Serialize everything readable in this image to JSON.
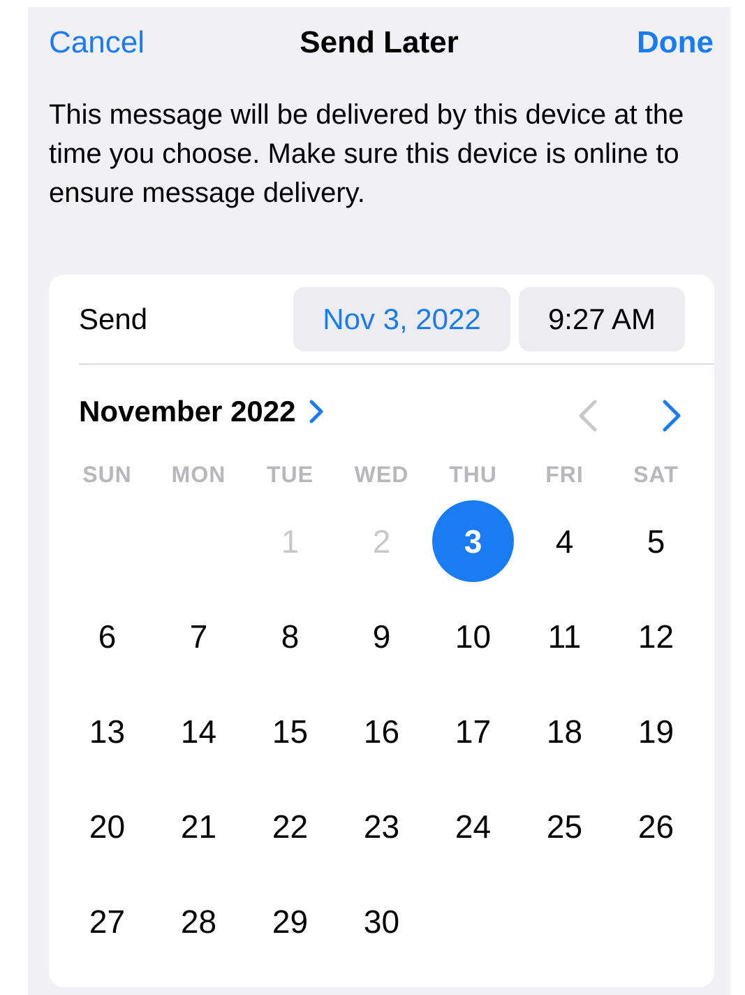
{
  "nav": {
    "cancel_label": "Cancel",
    "title": "Send Later",
    "done_label": "Done"
  },
  "info_text": "This message will be delivered by this device at the time you choose. Make sure this device is online to ensure message delivery.",
  "send_row": {
    "label": "Send",
    "date_value": "Nov 3, 2022",
    "time_value": "9:27 AM"
  },
  "calendar": {
    "month_label": "November 2022",
    "prev_icon": "chevron-left-icon",
    "next_icon": "chevron-right-icon",
    "weekdays": [
      "SUN",
      "MON",
      "TUE",
      "WED",
      "THU",
      "FRI",
      "SAT"
    ],
    "first_weekday_index": 2,
    "days_in_month": 30,
    "selected_day": 3,
    "disabled_days": [
      1,
      2
    ]
  },
  "colors": {
    "accent": "#1a7cf4",
    "sheet_background": "#f0f0f5",
    "card_background": "#ffffff",
    "pill_background": "#ececf1",
    "weekday_text": "#b7b7bc",
    "disabled_text": "#c8c8cc"
  }
}
